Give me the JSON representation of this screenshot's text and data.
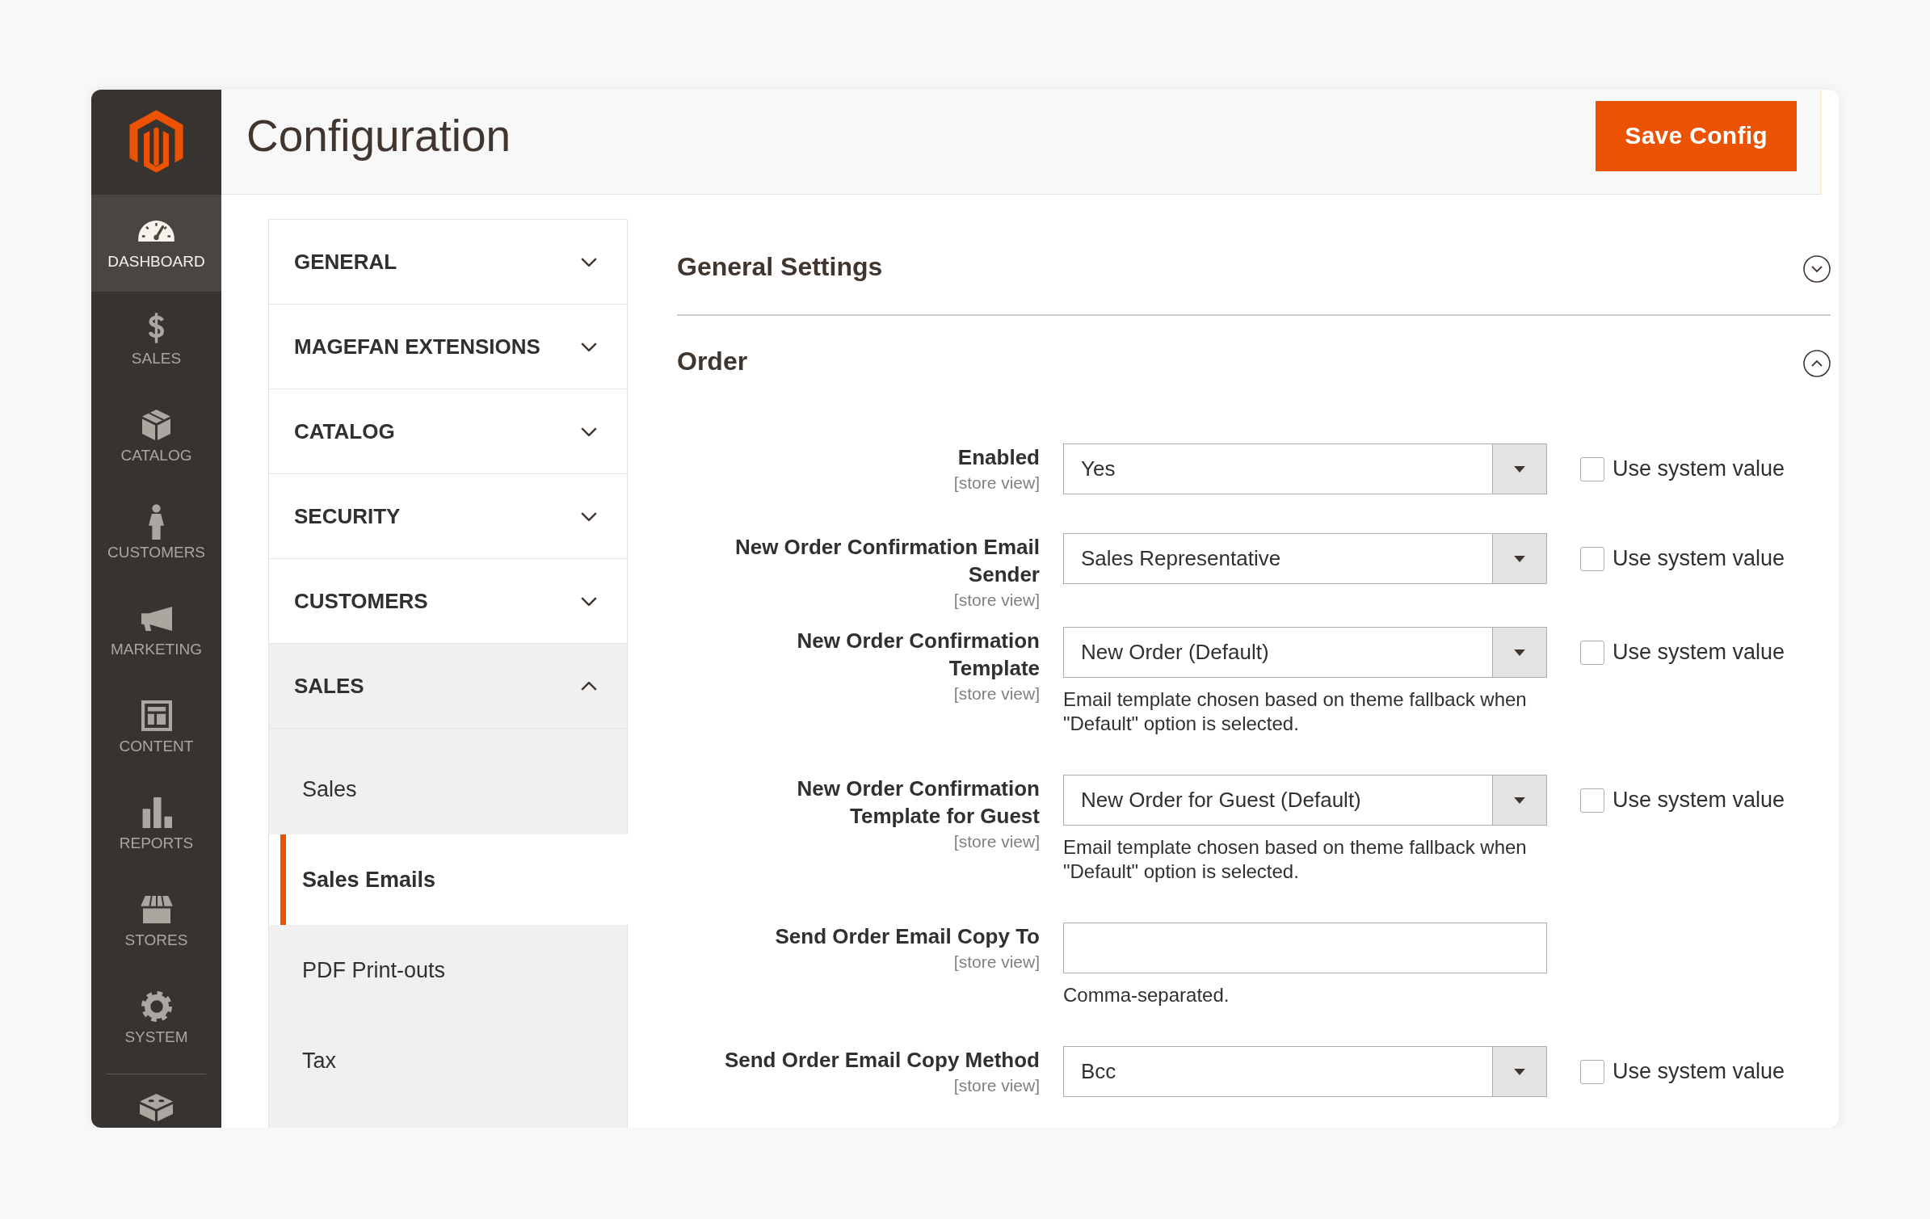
{
  "sidebar": {
    "items": [
      {
        "label": "DASHBOARD",
        "selected": true
      },
      {
        "label": "SALES",
        "selected": false
      },
      {
        "label": "CATALOG",
        "selected": false
      },
      {
        "label": "CUSTOMERS",
        "selected": false
      },
      {
        "label": "MARKETING",
        "selected": false
      },
      {
        "label": "CONTENT",
        "selected": false
      },
      {
        "label": "REPORTS",
        "selected": false
      },
      {
        "label": "STORES",
        "selected": false
      },
      {
        "label": "SYSTEM",
        "selected": false
      }
    ]
  },
  "header": {
    "title": "Configuration",
    "save_button": "Save Config"
  },
  "config_nav": [
    {
      "label": "GENERAL",
      "expanded": false
    },
    {
      "label": "MAGEFAN EXTENSIONS",
      "expanded": false
    },
    {
      "label": "CATALOG",
      "expanded": false
    },
    {
      "label": "SECURITY",
      "expanded": false
    },
    {
      "label": "CUSTOMERS",
      "expanded": false
    },
    {
      "label": "SALES",
      "expanded": true,
      "children": [
        {
          "label": "Sales",
          "selected": false
        },
        {
          "label": "Sales Emails",
          "selected": true
        },
        {
          "label": "PDF Print-outs",
          "selected": false
        },
        {
          "label": "Tax",
          "selected": false
        }
      ]
    }
  ],
  "sections": [
    {
      "title": "General Settings",
      "expanded": false
    },
    {
      "title": "Order",
      "expanded": true,
      "fields": [
        {
          "kind": "select",
          "label": "Enabled",
          "scope": "[store view]",
          "value": "Yes",
          "use_system": {
            "label": "Use system value",
            "checked": false
          }
        },
        {
          "kind": "select",
          "label": "New Order Confirmation Email Sender",
          "scope": "[store view]",
          "value": "Sales Representative",
          "use_system": {
            "label": "Use system value",
            "checked": false
          }
        },
        {
          "kind": "select",
          "label": "New Order Confirmation Template",
          "scope": "[store view]",
          "value": "New Order (Default)",
          "note": "Email template chosen based on theme fallback when \"Default\" option is selected.",
          "use_system": {
            "label": "Use system value",
            "checked": false
          }
        },
        {
          "kind": "select",
          "label": "New Order Confirmation Template for Guest",
          "scope": "[store view]",
          "value": "New Order for Guest (Default)",
          "note": "Email template chosen based on theme fallback when \"Default\" option is selected.",
          "use_system": {
            "label": "Use system value",
            "checked": false
          }
        },
        {
          "kind": "text",
          "label": "Send Order Email Copy To",
          "scope": "[store view]",
          "note": "Comma-separated."
        },
        {
          "kind": "select",
          "label": "Send Order Email Copy Method",
          "scope": "[store view]",
          "value": "Bcc",
          "use_system": {
            "label": "Use system value",
            "checked": false
          }
        }
      ]
    }
  ]
}
